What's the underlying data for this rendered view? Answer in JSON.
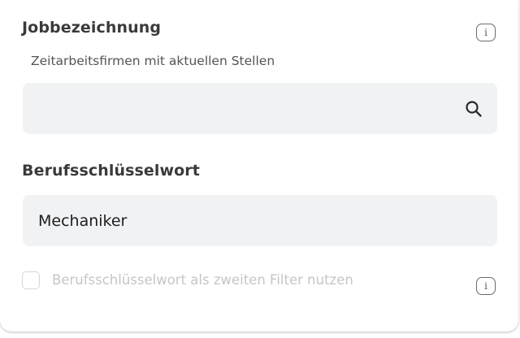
{
  "job_title_section": {
    "label": "Jobbezeichnung",
    "hint": "Zeitarbeitsfirmen mit aktuellen Stellen",
    "input_value": "",
    "info_icon": "info-icon",
    "search_icon": "search-icon"
  },
  "keyword_section": {
    "label": "Berufsschlüsselwort",
    "input_value": "Mechaniker"
  },
  "filter_option": {
    "label": "Berufsschlüsselwort als zweiten Filter nutzen",
    "checked": false,
    "info_icon": "info-icon"
  },
  "colors": {
    "field_background": "#f1f2f4",
    "label_text": "#3a3a3a",
    "disabled_text": "#c6c6c6"
  }
}
